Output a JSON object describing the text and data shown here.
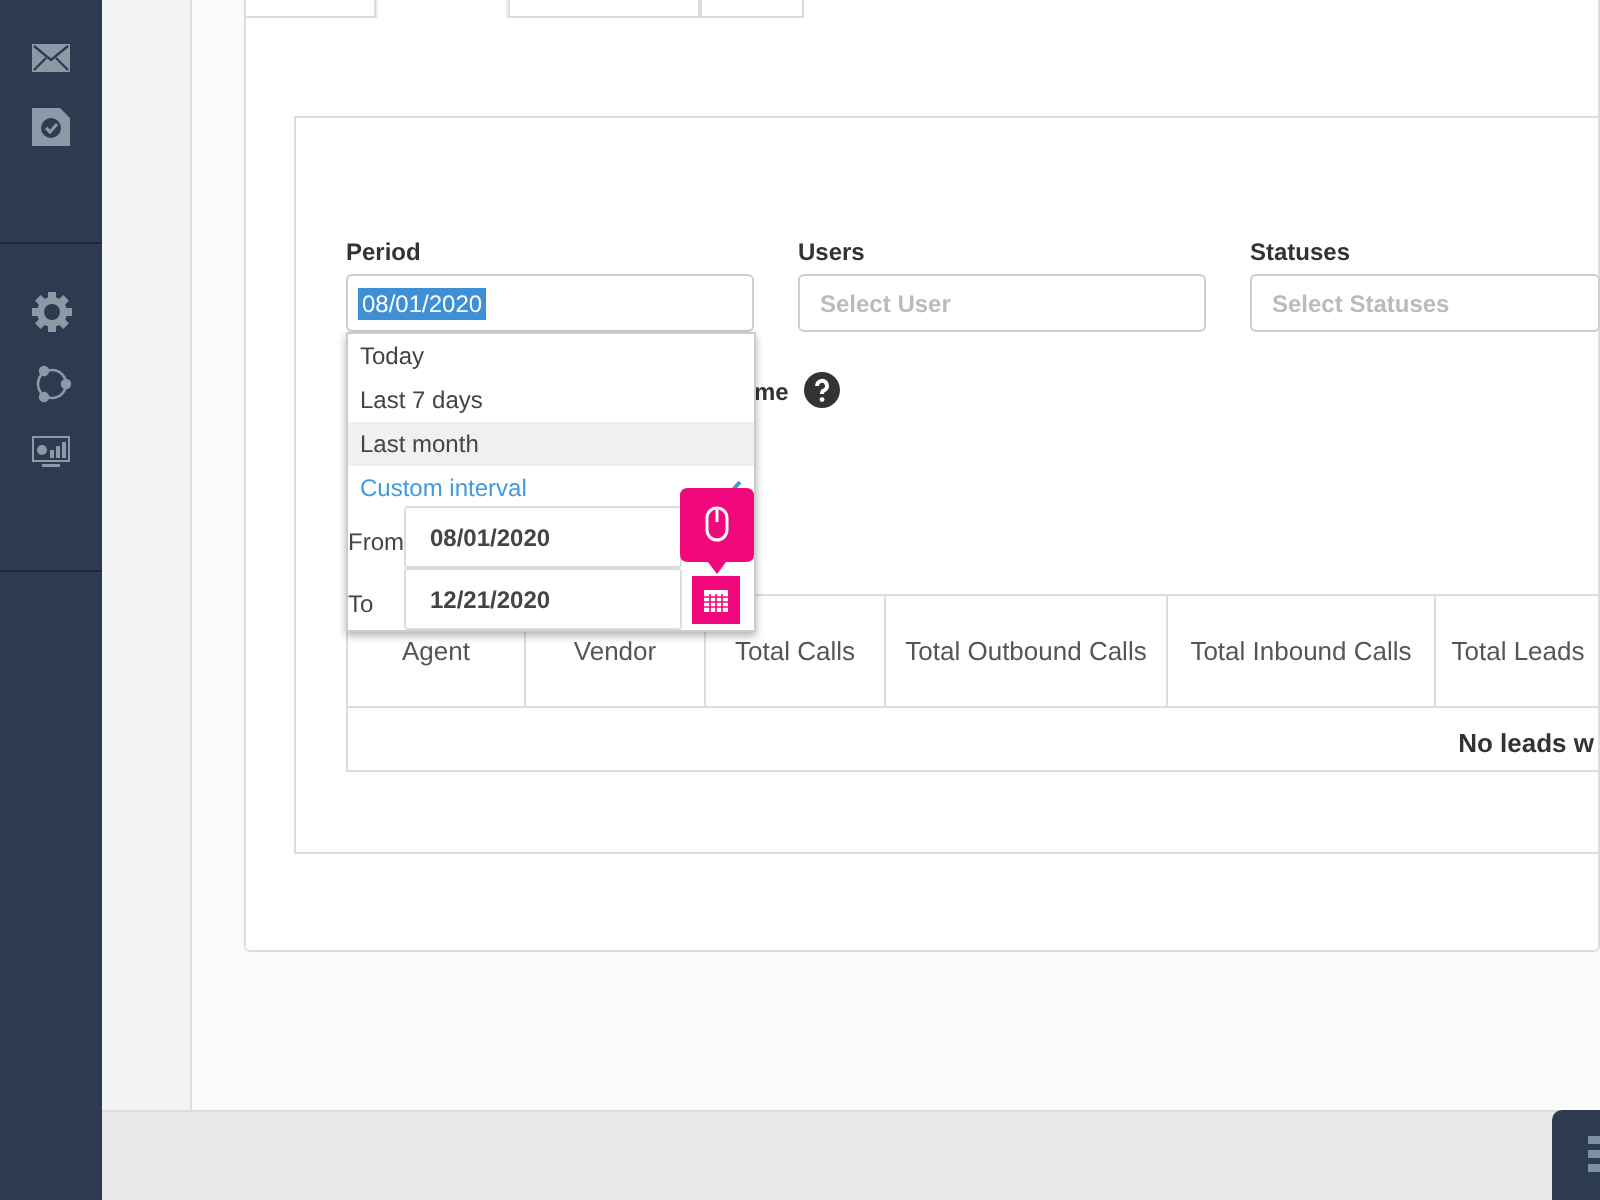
{
  "sidebar": {
    "items": [
      {
        "kind": "mail"
      },
      {
        "kind": "task"
      },
      {
        "kind": "settings"
      },
      {
        "kind": "share"
      },
      {
        "kind": "monitor"
      }
    ]
  },
  "tabs": [
    {
      "selected": false
    },
    {
      "selected": true
    },
    {
      "selected": false
    },
    {
      "selected": false
    }
  ],
  "filters": {
    "period": {
      "label": "Period",
      "value": "08/01/2020",
      "options": [
        {
          "label": "Today",
          "selected": false,
          "hovered": false
        },
        {
          "label": "Last 7 days",
          "selected": false,
          "hovered": false
        },
        {
          "label": "Last month",
          "selected": false,
          "hovered": true
        },
        {
          "label": "Custom interval",
          "selected": true,
          "hovered": false
        }
      ],
      "from_label": "From",
      "from_value": "08/01/2020",
      "to_label": "To",
      "to_value": "12/21/2020"
    },
    "users": {
      "label": "Users",
      "placeholder": "Select User"
    },
    "statuses": {
      "label": "Statuses",
      "placeholder": "Select Statuses"
    },
    "option_label": "me"
  },
  "table": {
    "columns": [
      "Agent",
      "Vendor",
      "Total Calls",
      "Total Outbound Calls",
      "Total Inbound Calls",
      "Total Leads"
    ],
    "empty_message": "No leads w"
  }
}
